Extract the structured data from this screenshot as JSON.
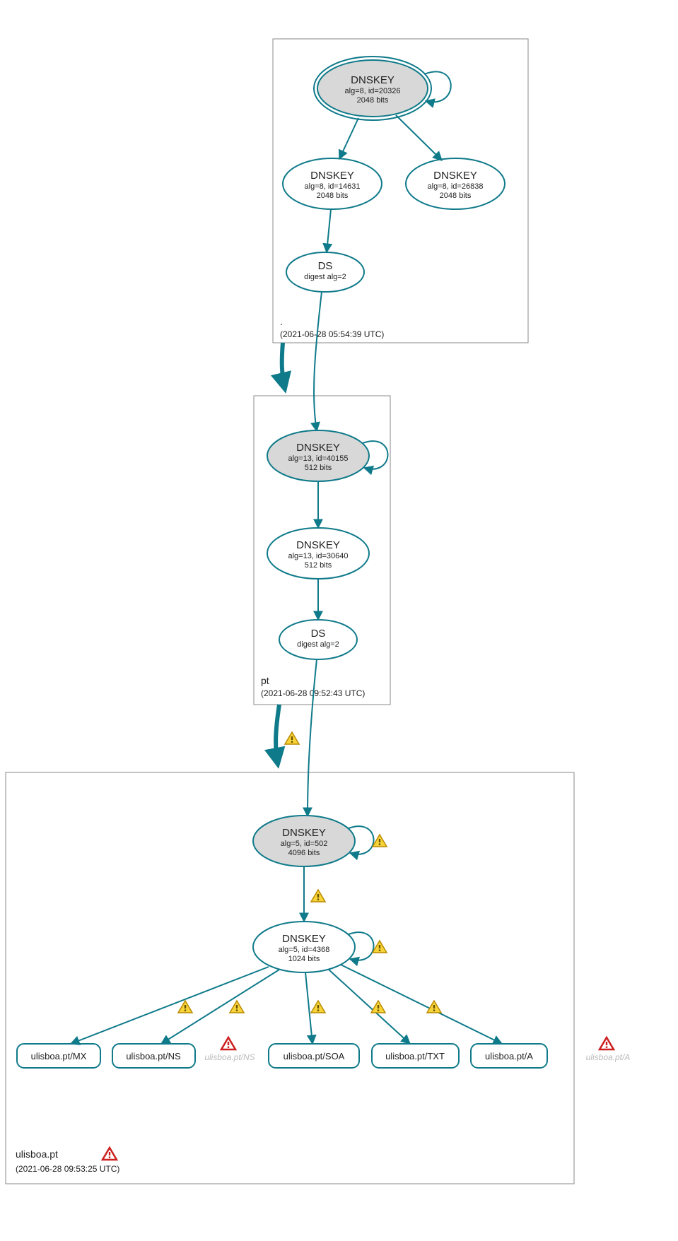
{
  "colors": {
    "stroke": "#0f7a8a",
    "shaded": "#d8d8d8"
  },
  "zones": {
    "root": {
      "name": ".",
      "timestamp": "(2021-06-28 05:54:39 UTC)"
    },
    "pt": {
      "name": "pt",
      "timestamp": "(2021-06-28 09:52:43 UTC)"
    },
    "ulisboa": {
      "name": "ulisboa.pt",
      "timestamp": "(2021-06-28 09:53:25 UTC)"
    }
  },
  "nodes": {
    "root_ksk": {
      "title": "DNSKEY",
      "line1": "alg=8, id=20326",
      "line2": "2048 bits"
    },
    "root_zsk1": {
      "title": "DNSKEY",
      "line1": "alg=8, id=14631",
      "line2": "2048 bits"
    },
    "root_zsk2": {
      "title": "DNSKEY",
      "line1": "alg=8, id=26838",
      "line2": "2048 bits"
    },
    "root_ds": {
      "title": "DS",
      "line1": "digest alg=2"
    },
    "pt_ksk": {
      "title": "DNSKEY",
      "line1": "alg=13, id=40155",
      "line2": "512 bits"
    },
    "pt_zsk": {
      "title": "DNSKEY",
      "line1": "alg=13, id=30640",
      "line2": "512 bits"
    },
    "pt_ds": {
      "title": "DS",
      "line1": "digest alg=2"
    },
    "ul_ksk": {
      "title": "DNSKEY",
      "line1": "alg=5, id=502",
      "line2": "4096 bits"
    },
    "ul_zsk": {
      "title": "DNSKEY",
      "line1": "alg=5, id=4368",
      "line2": "1024 bits"
    }
  },
  "rrsets": {
    "mx": "ulisboa.pt/MX",
    "ns": "ulisboa.pt/NS",
    "soa": "ulisboa.pt/SOA",
    "txt": "ulisboa.pt/TXT",
    "a": "ulisboa.pt/A"
  },
  "ghosts": {
    "ns": "ulisboa.pt/NS",
    "a": "ulisboa.pt/A"
  },
  "icons": {
    "warning": "warning-icon",
    "error": "error-icon"
  }
}
